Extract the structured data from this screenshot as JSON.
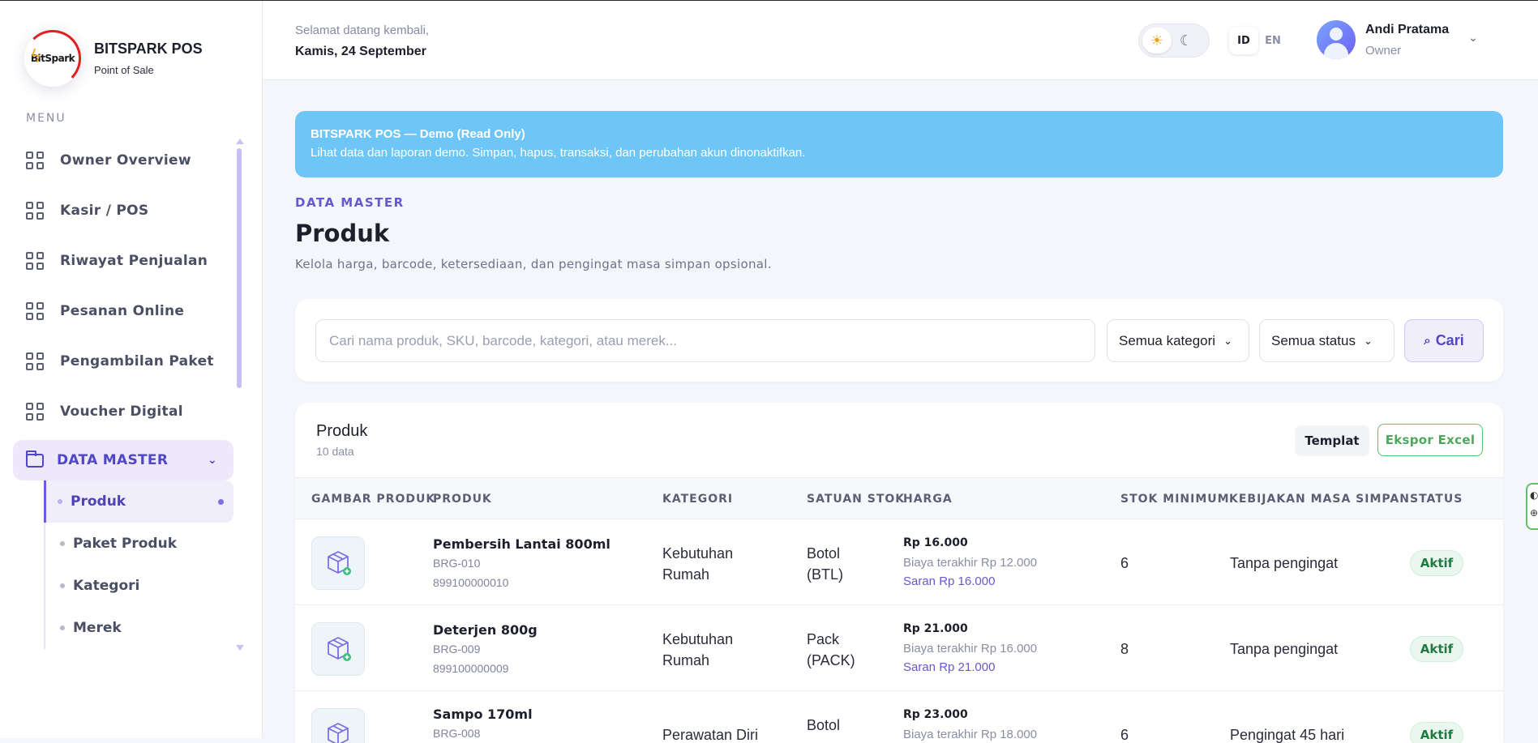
{
  "brand": {
    "logo_text": "BitSpark",
    "title": "BITSPARK POS",
    "subtitle": "Point of Sale"
  },
  "sidebar": {
    "menu_label": "MENU",
    "items": [
      {
        "label": "Owner Overview"
      },
      {
        "label": "Kasir / POS"
      },
      {
        "label": "Riwayat Penjualan"
      },
      {
        "label": "Pesanan Online"
      },
      {
        "label": "Pengambilan Paket"
      },
      {
        "label": "Voucher Digital"
      }
    ],
    "group": {
      "label": "DATA MASTER",
      "expanded": true
    },
    "subitems": [
      {
        "label": "Produk",
        "active": true
      },
      {
        "label": "Paket Produk"
      },
      {
        "label": "Kategori"
      },
      {
        "label": "Merek"
      }
    ]
  },
  "header": {
    "greeting": "Selamat datang kembali,",
    "date": "Kamis, 24 September",
    "theme": {
      "active": "light",
      "light_icon": "sun-icon",
      "dark_icon": "moon-icon"
    },
    "lang": {
      "options": [
        "ID",
        "EN"
      ],
      "active": "ID"
    },
    "user": {
      "name": "Andi Pratama",
      "role": "Owner"
    }
  },
  "banner": {
    "title": "BITSPARK POS — Demo (Read Only)",
    "text": "Lihat data dan laporan demo. Simpan, hapus, transaksi, dan perubahan akun dinonaktifkan."
  },
  "page": {
    "eyebrow": "DATA MASTER",
    "title": "Produk",
    "subtitle": "Kelola harga, barcode, ketersediaan, dan pengingat masa simpan opsional."
  },
  "filters": {
    "search_placeholder": "Cari nama produk, SKU, barcode, kategori, atau merek...",
    "category": "Semua kategori",
    "status": "Semua status",
    "search_button": "Cari"
  },
  "table": {
    "title": "Produk",
    "count": "10 data",
    "template_button": "Templat",
    "export_button": "Ekspor Excel",
    "columns": [
      "GAMBAR PRODUK",
      "PRODUK",
      "KATEGORI",
      "SATUAN STOK",
      "HARGA",
      "STOK MINIMUM",
      "KEBIJAKAN MASA SIMPAN",
      "STATUS"
    ],
    "rows": [
      {
        "name": "Pembersih Lantai 800ml",
        "sku": "BRG-010",
        "barcode": "899100000010",
        "category_1": "Kebutuhan",
        "category_2": "Rumah",
        "unit_1": "Botol",
        "unit_2": "(BTL)",
        "price": "Rp 16.000",
        "cost": "Biaya terakhir Rp 12.000",
        "suggest": "Saran Rp 16.000",
        "min_stock": "6",
        "policy": "Tanpa pengingat",
        "status": "Aktif"
      },
      {
        "name": "Deterjen 800g",
        "sku": "BRG-009",
        "barcode": "899100000009",
        "category_1": "Kebutuhan",
        "category_2": "Rumah",
        "unit_1": "Pack",
        "unit_2": "(PACK)",
        "price": "Rp 21.000",
        "cost": "Biaya terakhir Rp 16.000",
        "suggest": "Saran Rp 21.000",
        "min_stock": "8",
        "policy": "Tanpa pengingat",
        "status": "Aktif"
      },
      {
        "name": "Sampo 170ml",
        "sku": "BRG-008",
        "barcode": "",
        "category_1": "Perawatan Diri",
        "category_2": "",
        "unit_1": "Botol",
        "unit_2": "",
        "price": "Rp 23.000",
        "cost": "Biaya terakhir Rp 18.000",
        "suggest": "",
        "min_stock": "6",
        "policy": "Pengingat 45 hari",
        "status": "Aktif"
      }
    ]
  }
}
